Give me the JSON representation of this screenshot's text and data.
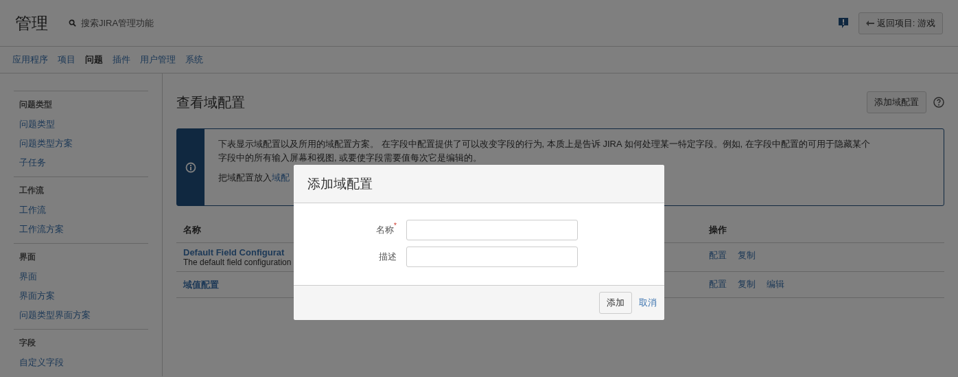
{
  "header": {
    "title": "管理",
    "search": {
      "placeholder": "搜索JIRA管理功能"
    },
    "back_button": "返回项目: 游戏"
  },
  "nav": [
    {
      "label": "应用程序",
      "selected": false
    },
    {
      "label": "项目",
      "selected": false
    },
    {
      "label": "问题",
      "selected": true
    },
    {
      "label": "插件",
      "selected": false
    },
    {
      "label": "用户管理",
      "selected": false
    },
    {
      "label": "系统",
      "selected": false
    }
  ],
  "sidebar": [
    {
      "heading": "问题类型",
      "items": [
        "问题类型",
        "问题类型方案",
        "子任务"
      ]
    },
    {
      "heading": "工作流",
      "items": [
        "工作流",
        "工作流方案"
      ]
    },
    {
      "heading": "界面",
      "items": [
        "界面",
        "界面方案",
        "问题类型界面方案"
      ]
    },
    {
      "heading": "字段",
      "items": [
        "自定义字段"
      ]
    }
  ],
  "page": {
    "title": "查看域配置",
    "add_button": "添加域配置"
  },
  "info": {
    "paragraph": "下表显示域配置以及所用的域配置方案。 在字段中配置提供了可以改变字段的行为, 本质上是告诉 JIRA 如何处理某一特定字段。例如, 在字段中配置的可用于隐藏某个字段中的所有输入屏幕和视图, 或要使字段需要值每次它是编辑的。",
    "second_text": "把域配置放入",
    "second_link": "域配"
  },
  "table": {
    "columns": [
      "名称",
      "操作"
    ],
    "rows": [
      {
        "name": "Default Field Configurat",
        "description": "The default field configuration",
        "actions": [
          "配置",
          "复制"
        ]
      },
      {
        "name": "域值配置",
        "actions": [
          "配置",
          "复制",
          "编辑"
        ]
      }
    ]
  },
  "dialog": {
    "title": "添加域配置",
    "fields": [
      {
        "label": "名称",
        "required": true
      },
      {
        "label": "描述",
        "required": false
      }
    ],
    "required_mark": "*",
    "submit": "添加",
    "cancel": "取消"
  }
}
